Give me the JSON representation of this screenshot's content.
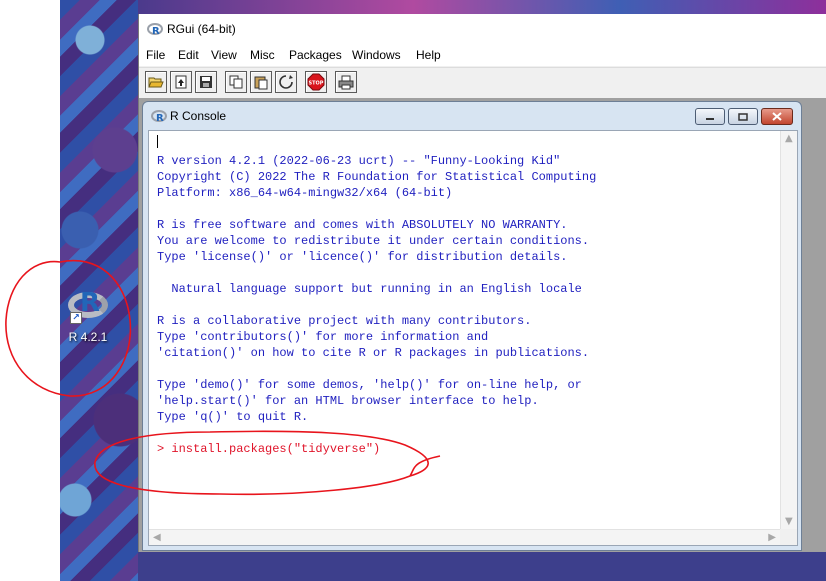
{
  "desktop": {
    "shortcut_label": "R 4.2.1"
  },
  "rgui": {
    "title": "RGui (64-bit)",
    "menu": [
      "File",
      "Edit",
      "View",
      "Misc",
      "Packages",
      "Windows",
      "Help"
    ],
    "toolbar": [
      {
        "name": "open-script-icon"
      },
      {
        "name": "load-workspace-icon"
      },
      {
        "name": "save-workspace-icon"
      },
      {
        "name": "copy-icon"
      },
      {
        "name": "paste-icon"
      },
      {
        "name": "copy-paste-icon"
      },
      {
        "name": "stop-icon",
        "text": "STOP"
      },
      {
        "name": "print-icon"
      }
    ]
  },
  "console": {
    "title": "R Console",
    "lines": [
      "",
      "R version 4.2.1 (2022-06-23 ucrt) -- \"Funny-Looking Kid\"",
      "Copyright (C) 2022 The R Foundation for Statistical Computing",
      "Platform: x86_64-w64-mingw32/x64 (64-bit)",
      "",
      "R is free software and comes with ABSOLUTELY NO WARRANTY.",
      "You are welcome to redistribute it under certain conditions.",
      "Type 'license()' or 'licence()' for distribution details.",
      "",
      "  Natural language support but running in an English locale",
      "",
      "R is a collaborative project with many contributors.",
      "Type 'contributors()' for more information and",
      "'citation()' on how to cite R or R packages in publications.",
      "",
      "Type 'demo()' for some demos, 'help()' for on-line help, or",
      "'help.start()' for an HTML browser interface to help.",
      "Type 'q()' to quit R.",
      ""
    ],
    "command": "> install.packages(\"tidyverse\")"
  },
  "colors": {
    "output_text": "#1f1fbf",
    "command_text": "#e0142a",
    "annotation": "#e8141c"
  }
}
